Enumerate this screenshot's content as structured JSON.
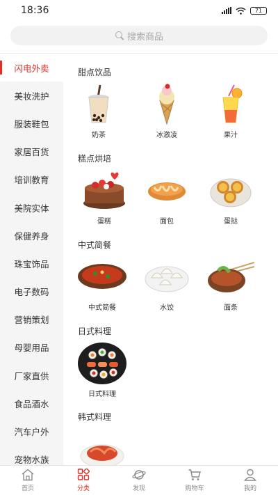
{
  "status": {
    "time": "18:36",
    "battery": "71"
  },
  "search": {
    "placeholder": "搜索商品"
  },
  "sidebar": {
    "items": [
      {
        "label": "闪电外卖"
      },
      {
        "label": "美妆洗护"
      },
      {
        "label": "服装鞋包"
      },
      {
        "label": "家居百货"
      },
      {
        "label": "培训教育"
      },
      {
        "label": "美院实体"
      },
      {
        "label": "保健养身"
      },
      {
        "label": "珠宝饰品"
      },
      {
        "label": "电子数码"
      },
      {
        "label": "营销策划"
      },
      {
        "label": "母婴用品"
      },
      {
        "label": "厂家直供"
      },
      {
        "label": "食品酒水"
      },
      {
        "label": "汽车户外"
      },
      {
        "label": "宠物水族"
      }
    ]
  },
  "sections": [
    {
      "title": "甜点饮品",
      "items": [
        {
          "label": "奶茶",
          "icon": "milk-tea-icon"
        },
        {
          "label": "冰激凌",
          "icon": "ice-cream-icon"
        },
        {
          "label": "果汁",
          "icon": "juice-icon"
        }
      ]
    },
    {
      "title": "糕点烘培",
      "items": [
        {
          "label": "蛋糕",
          "icon": "cake-icon"
        },
        {
          "label": "面包",
          "icon": "bread-icon"
        },
        {
          "label": "蛋挞",
          "icon": "egg-tart-icon"
        }
      ]
    },
    {
      "title": "中式简餐",
      "items": [
        {
          "label": "中式简餐",
          "icon": "chinese-meal-icon"
        },
        {
          "label": "水饺",
          "icon": "dumplings-icon"
        },
        {
          "label": "面条",
          "icon": "noodles-icon"
        }
      ]
    },
    {
      "title": "日式料理",
      "items": [
        {
          "label": "日式料理",
          "icon": "sushi-icon"
        }
      ]
    },
    {
      "title": "韩式料理",
      "items": [
        {
          "label": "",
          "icon": "korean-dish-icon"
        }
      ]
    }
  ],
  "tabbar": {
    "tabs": [
      {
        "label": "首页",
        "icon": "home-icon"
      },
      {
        "label": "分类",
        "icon": "category-icon"
      },
      {
        "label": "发现",
        "icon": "planet-icon"
      },
      {
        "label": "购物车",
        "icon": "cart-icon"
      },
      {
        "label": "我的",
        "icon": "user-icon"
      }
    ]
  },
  "colors": {
    "accent": "#e02e24",
    "sidebar_bg": "#f5f5f5",
    "search_bg": "#f2f2f2"
  }
}
